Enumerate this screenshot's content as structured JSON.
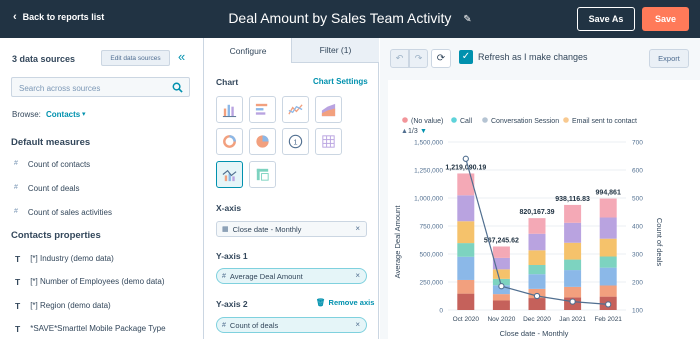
{
  "header": {
    "back_label": "Back to reports list",
    "title": "Deal Amount by Sales Team Activity",
    "save_as_label": "Save As",
    "save_label": "Save",
    "bg_color": "#213343",
    "save_color": "#ff7a59"
  },
  "sources": {
    "count_label": "3 data sources",
    "edit_label": "Edit data sources",
    "search_placeholder": "Search across sources",
    "browse_label": "Browse:",
    "browse_value": "Contacts",
    "default_measures_title": "Default measures",
    "measures": [
      "Count of contacts",
      "Count of deals",
      "Count of sales activities"
    ],
    "properties_title": "Contacts properties",
    "properties": [
      "[*] Industry (demo data)",
      "[*] Number of Employees (demo data)",
      "[*] Region (demo data)",
      "*SAVE*Smarttel Mobile Package Type"
    ]
  },
  "config": {
    "tab_configure": "Configure",
    "tab_filter": "Filter (1)",
    "chart_label": "Chart",
    "chart_settings_label": "Chart Settings",
    "chart_types": [
      "vertical-bar-icon",
      "horizontal-bar-icon",
      "line-icon",
      "area-icon",
      "donut-icon",
      "pie-icon",
      "summary-icon",
      "table-icon",
      "combo-icon",
      "pivot-icon"
    ],
    "x_axis_label": "X-axis",
    "x_axis_value": "Close date - Monthly",
    "y1_label": "Y-axis 1",
    "y1_value": "Average Deal Amount",
    "y2_label": "Y-axis 2",
    "y2_value": "Count of deals",
    "remove_axis_label": "Remove axis"
  },
  "toolbar": {
    "refresh_label": "Refresh as I make changes",
    "export_label": "Export",
    "accent_color": "#0091ae"
  },
  "chart_data": {
    "type": "bar",
    "stacked": true,
    "legend": [
      "(No value)",
      "Call",
      "Conversation Session",
      "Email sent to contact"
    ],
    "legend_colors": [
      "#f2959a",
      "#5fd3da",
      "#b5c4d3",
      "#f8c990"
    ],
    "legend_page": "1/3",
    "categories": [
      "Oct 2020",
      "Nov 2020",
      "Dec 2020",
      "Jan 2021",
      "Feb 2021"
    ],
    "totals": [
      1219090.19,
      567245.62,
      820167.39,
      938116.83,
      994861
    ],
    "total_labels": [
      "1,219,090.19",
      "567,245.62",
      "820,167.39",
      "938,116.83",
      "994,861"
    ],
    "segment_colors": [
      "#c5615b",
      "#f2a07e",
      "#8bb8e8",
      "#7dd3c0",
      "#f5c26b",
      "#b9a3e0",
      "#f4a9b6"
    ],
    "segment_shares": [
      [
        0.12,
        0.1,
        0.17,
        0.1,
        0.16,
        0.19,
        0.16
      ],
      [
        0.15,
        0.1,
        0.14,
        0.1,
        0.15,
        0.18,
        0.18
      ],
      [
        0.13,
        0.1,
        0.16,
        0.1,
        0.16,
        0.18,
        0.17
      ],
      [
        0.12,
        0.1,
        0.16,
        0.1,
        0.16,
        0.19,
        0.17
      ],
      [
        0.12,
        0.1,
        0.16,
        0.1,
        0.16,
        0.19,
        0.17
      ]
    ],
    "count_of_deals": [
      640,
      185,
      150,
      130,
      120
    ],
    "xlabel": "Close date - Monthly",
    "ylabel": "Average Deal Amount",
    "y2label": "Count of deals",
    "ylim": [
      0,
      1500000
    ],
    "y2lim": [
      100,
      700
    ],
    "y_ticks": [
      "0",
      "250,000",
      "500,000",
      "750,000",
      "1,000,000",
      "1,250,000",
      "1,500,000"
    ],
    "y2_ticks": [
      "100",
      "200",
      "300",
      "400",
      "500",
      "600",
      "700"
    ],
    "line_color": "#516f90",
    "grid": true
  }
}
